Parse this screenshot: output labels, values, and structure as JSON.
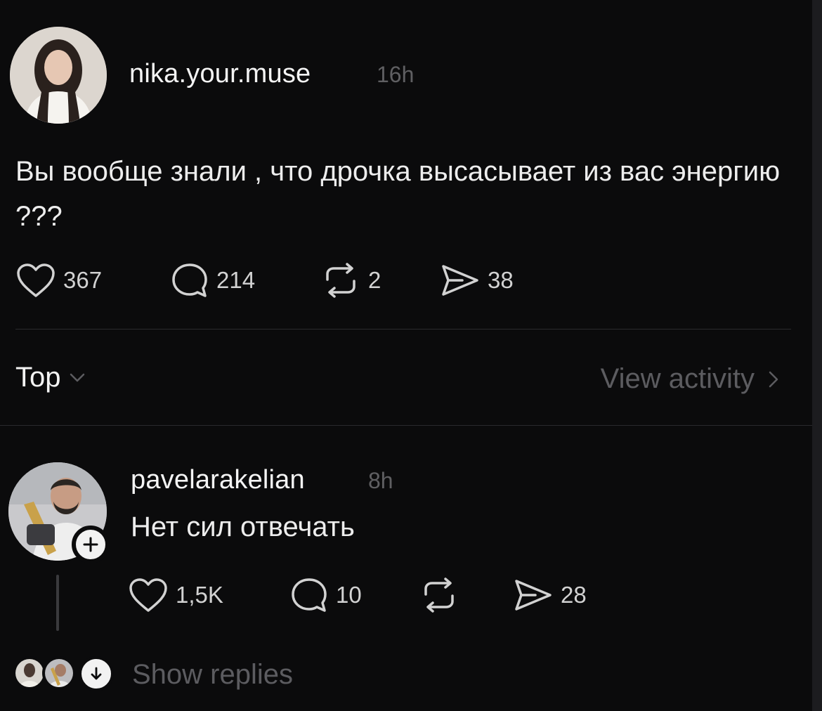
{
  "post": {
    "username": "nika.your.muse",
    "time": "16h",
    "text": "Вы вообще знали , что дрочка высасывает из вас энергию ???",
    "stats": {
      "likes": "367",
      "comments": "214",
      "reposts": "2",
      "shares": "38"
    }
  },
  "filter": {
    "sort_label": "Top",
    "view_activity": "View activity"
  },
  "reply": {
    "username": "pavelarakelian",
    "time": "8h",
    "text": "Нет сил отвечать",
    "stats": {
      "likes": "1,5K",
      "comments": "10",
      "shares": "28"
    },
    "show_replies": "Show replies"
  },
  "icons": {
    "like": "heart-icon",
    "comment": "comment-bubble-icon",
    "repost": "repost-icon",
    "share": "share-send-icon",
    "follow": "plus-icon",
    "expand": "chevron-down-icon",
    "next": "chevron-right-icon",
    "show_replies": "arrow-down-icon"
  },
  "colors": {
    "background": "#0b0b0c",
    "primary_text": "#f2f2f2",
    "secondary_text": "#5c5c60",
    "divider": "#2a2a2d"
  }
}
